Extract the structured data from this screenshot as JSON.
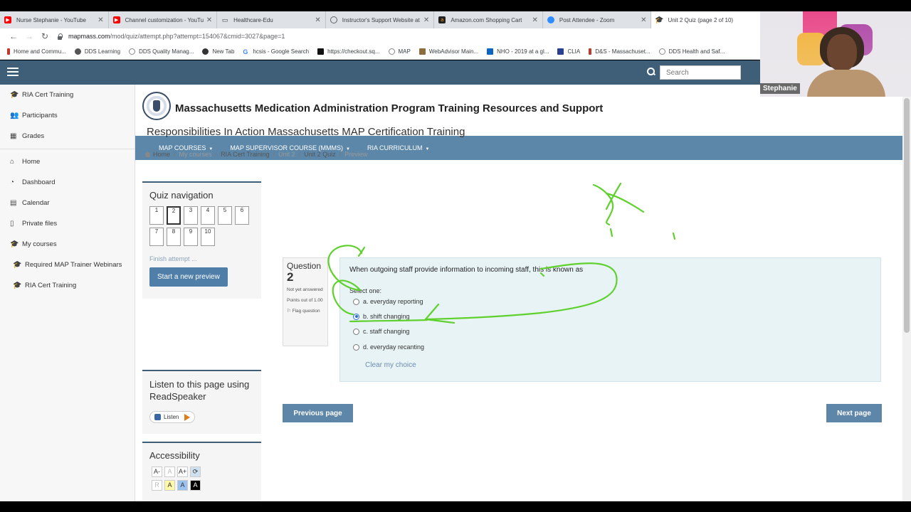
{
  "browser": {
    "tabs": [
      {
        "title": "Nurse Stephanie - YouTube",
        "favicon": "youtube-icon",
        "color": "#ff0000"
      },
      {
        "title": "Channel customization - YouTube",
        "favicon": "youtube-icon",
        "color": "#ff0000"
      },
      {
        "title": "Healthcare-Edu",
        "favicon": "page-icon",
        "color": "#3c4043"
      },
      {
        "title": "Instructor's Support Website at",
        "favicon": "globe-icon",
        "color": "#5f6368"
      },
      {
        "title": "Amazon.com Shopping Cart",
        "favicon": "amazon-icon",
        "color": "#222"
      },
      {
        "title": "Post Attendee - Zoom",
        "favicon": "zoom-icon",
        "color": "#2d8cff"
      },
      {
        "title": "Unit 2 Quiz (page 2 of 10)",
        "favicon": "moodle-icon",
        "color": "#f7a11a"
      }
    ],
    "url_host": "mapmass.com",
    "url_path": "/mod/quiz/attempt.php?attempt=154067&cmid=3027&page=1",
    "bookmarks": [
      {
        "label": "Home and Commu...",
        "color": "#c0392b"
      },
      {
        "label": "DDS Learning",
        "color": "#555"
      },
      {
        "label": "DDS Quality Manag...",
        "color": "#888"
      },
      {
        "label": "New Tab",
        "color": "#333"
      },
      {
        "label": "hcsis - Google Search",
        "color": "#4285f4"
      },
      {
        "label": "https://checkout.sq...",
        "color": "#111"
      },
      {
        "label": "MAP",
        "color": "#888"
      },
      {
        "label": "WebAdvisor Main...",
        "color": "#8a6d3b"
      },
      {
        "label": "NHO - 2019 at a gl...",
        "color": "#0a66c2"
      },
      {
        "label": "CLIA",
        "color": "#2a3f8f"
      },
      {
        "label": "D&S - Massachuset...",
        "color": "#c0392b"
      },
      {
        "label": "DDS Health and Saf...",
        "color": "#888"
      }
    ]
  },
  "moodle": {
    "search_placeholder": "Search",
    "drawer": [
      {
        "label": "RIA Cert Training",
        "icon": "graduation-cap-icon"
      },
      {
        "label": "Participants",
        "icon": "users-icon"
      },
      {
        "label": "Grades",
        "icon": "table-icon"
      },
      {
        "label": "Home",
        "icon": "home-icon"
      },
      {
        "label": "Dashboard",
        "icon": "dashboard-icon"
      },
      {
        "label": "Calendar",
        "icon": "calendar-icon"
      },
      {
        "label": "Private files",
        "icon": "file-icon"
      },
      {
        "label": "My courses",
        "icon": "graduation-cap-icon"
      },
      {
        "label": "Required MAP Trainer Webinars",
        "icon": "graduation-cap-icon"
      },
      {
        "label": "RIA Cert Training",
        "icon": "graduation-cap-icon"
      }
    ],
    "site_title": "Massachusetts Medication Administration Program Training Resources and Support",
    "mainnav": [
      "MAP COURSES",
      "MAP SUPERVISOR COURSE (MMMS)",
      "RIA CURRICULUM"
    ],
    "course_title": "Responsibilities In Action Massachusetts MAP Certification Training",
    "breadcrumb": [
      "Home",
      "My courses",
      "RIA Cert Training",
      "Unit 2",
      "Unit 2 Quiz",
      "Preview"
    ],
    "quiz_nav": {
      "title": "Quiz navigation",
      "questions": [
        "1",
        "2",
        "3",
        "4",
        "5",
        "6",
        "7",
        "8",
        "9",
        "10"
      ],
      "current": "2",
      "finish_label": "Finish attempt ...",
      "start_preview_label": "Start a new preview"
    },
    "readspeaker": {
      "title": "Listen to this page using ReadSpeaker",
      "listen_label": "Listen"
    },
    "accessibility": {
      "title": "Accessibility",
      "size_buttons": [
        "A-",
        "A",
        "A+"
      ],
      "color_buttons": [
        "R",
        "A",
        "A",
        "A"
      ]
    },
    "question": {
      "label": "Question",
      "number": "2",
      "status": "Not yet answered",
      "points": "Points out of 1.00",
      "flag": "Flag question",
      "text": "When outgoing staff provide information to incoming staff, this is known as",
      "select_one": "Select one:",
      "answers": [
        {
          "label": "a. everyday reporting",
          "checked": false
        },
        {
          "label": "b. shift changing",
          "checked": true
        },
        {
          "label": "c. staff changing",
          "checked": false
        },
        {
          "label": "d. everyday recanting",
          "checked": false
        }
      ],
      "clear_label": "Clear my choice"
    },
    "prev_label": "Previous page",
    "next_label": "Next page"
  },
  "zoom": {
    "participant_name": "Stephanie"
  },
  "colors": {
    "navbar": "#3f5e77",
    "mainnav": "#5d87a8",
    "annotation": "#5fd12c",
    "question_bg": "#e8f3f6"
  }
}
